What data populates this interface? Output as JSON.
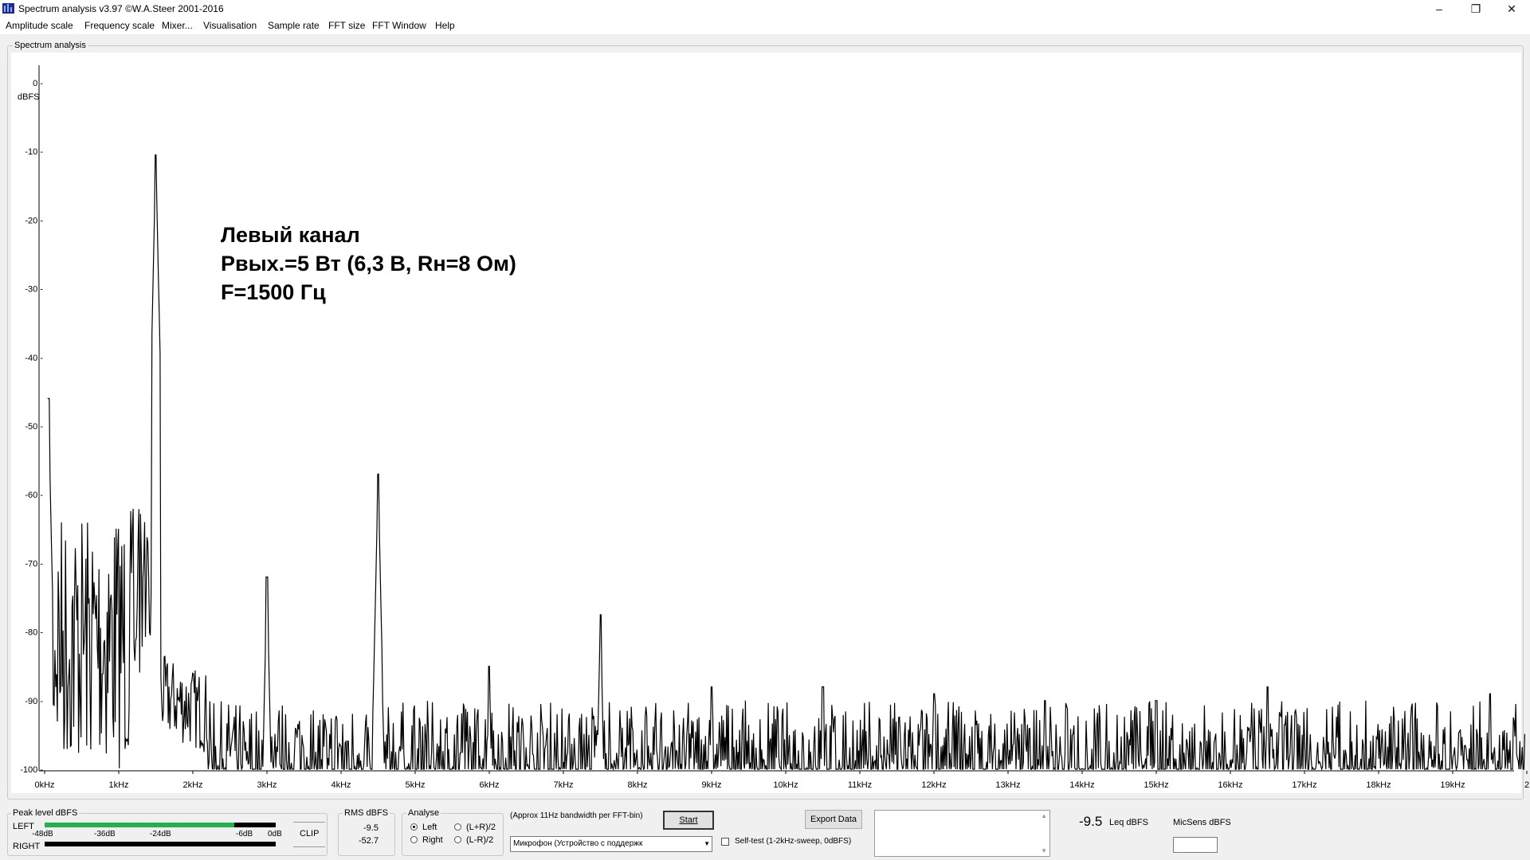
{
  "window": {
    "title": "Spectrum analysis v3.97   ©W.A.Steer 2001-2016",
    "minimize": "–",
    "maximize": "❐",
    "close": "✕"
  },
  "menu": [
    "Amplitude scale",
    "Frequency scale",
    "Mixer...",
    "Visualisation",
    "Sample rate",
    "FFT size",
    "FFT Window",
    "Help"
  ],
  "panel": {
    "caption": "Spectrum analysis"
  },
  "annotation": {
    "line1": "Левый канал",
    "line2": "Рвых.=5 Вт (6,3 В, Rн=8 Ом)",
    "line3": "F=1500 Гц"
  },
  "chart_data": {
    "type": "line",
    "ylabel": "dBFS",
    "ylim": [
      -100,
      0
    ],
    "yticks": [
      "0 -",
      "-10 -",
      "-20 -",
      "-30 -",
      "-40 -",
      "-50 -",
      "-60 -",
      "-70 -",
      "-80 -",
      "-90 -",
      "-100 -"
    ],
    "xlim_khz": [
      0,
      20
    ],
    "xticks": [
      "0kHz",
      "1kHz",
      "2kHz",
      "3kHz",
      "4kHz",
      "5kHz",
      "6kHz",
      "7kHz",
      "8kHz",
      "9kHz",
      "10kHz",
      "11kHz",
      "12kHz",
      "13kHz",
      "14kHz",
      "15kHz",
      "16kHz",
      "17kHz",
      "18kHz",
      "19kHz",
      "2"
    ],
    "line_color": "#000000",
    "noise_floor_db": [
      -100,
      -92
    ],
    "peaks": [
      {
        "khz": 0.05,
        "db": -46
      },
      {
        "khz": 1.5,
        "db": -10.5
      },
      {
        "khz": 3.0,
        "db": -72
      },
      {
        "khz": 4.5,
        "db": -57
      },
      {
        "khz": 6.0,
        "db": -85
      },
      {
        "khz": 7.5,
        "db": -77.5
      },
      {
        "khz": 9.0,
        "db": -88
      },
      {
        "khz": 10.5,
        "db": -88
      },
      {
        "khz": 12.0,
        "db": -89
      },
      {
        "khz": 13.5,
        "db": -90
      },
      {
        "khz": 15.0,
        "db": -90
      },
      {
        "khz": 16.5,
        "db": -88
      },
      {
        "khz": 19.5,
        "db": -89
      }
    ]
  },
  "peak_level": {
    "caption": "Peak level dBFS",
    "left": "LEFT",
    "right": "RIGHT",
    "scale": [
      "-48dB",
      "-36dB",
      "-24dB",
      "-6dB",
      "0dB"
    ],
    "left_level": 0.82,
    "right_level": 0.0,
    "clip": "CLIP"
  },
  "rms": {
    "caption": "RMS dBFS",
    "left": "-9.5",
    "right": "-52.7"
  },
  "analyse": {
    "caption": "Analyse",
    "left": "Left",
    "right": "Right",
    "sum": "(L+R)/2",
    "diff": "(L-R)/2",
    "selected": "Left"
  },
  "bandwidth_note": "(Approx 11Hz bandwidth per FFT-bin)",
  "start_button": "Start",
  "export_button": "Export Data",
  "device": "Микрофон (Устройство с поддержк",
  "self_test": "Self-test  (1-2kHz-sweep, 0dBFS)",
  "leq": {
    "value": "-9.5",
    "unit": "Leq dBFS"
  },
  "micsens": {
    "label": "MicSens dBFS",
    "value": ""
  }
}
